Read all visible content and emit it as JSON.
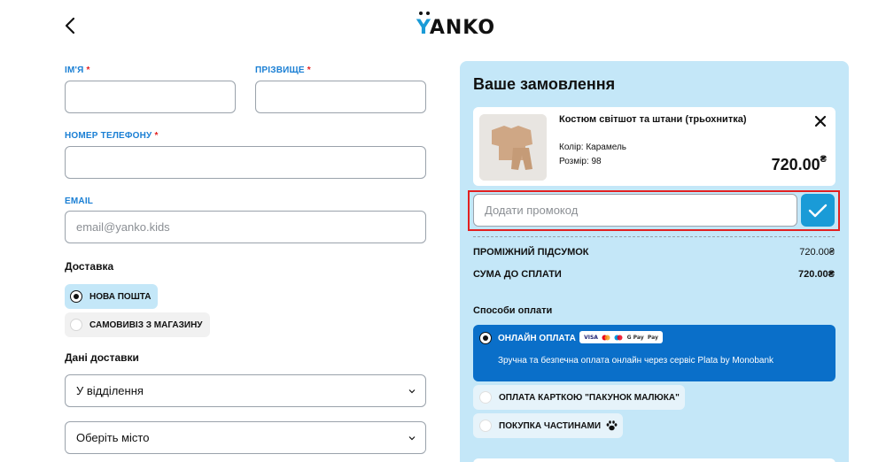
{
  "header": {
    "logo_text": "ANKO",
    "logo_letter": "Y"
  },
  "form": {
    "first_name": {
      "label": "ІМ'Я",
      "required_mark": "*",
      "value": ""
    },
    "last_name": {
      "label": "ПРІЗВИЩЕ",
      "required_mark": "*",
      "value": ""
    },
    "phone": {
      "label": "НОМЕР ТЕЛЕФОНУ",
      "required_mark": "*",
      "value": ""
    },
    "email": {
      "label": "EMAIL",
      "placeholder": "email@yanko.kids",
      "value": ""
    },
    "delivery": {
      "title": "Доставка",
      "options": [
        {
          "label": "НОВА ПОШТА",
          "selected": true
        },
        {
          "label": "САМОВИВІЗ З МАГАЗИНУ",
          "selected": false
        }
      ]
    },
    "delivery_data": {
      "title": "Дані доставки",
      "method_select": "У відділення",
      "city_select": "Оберіть місто"
    }
  },
  "order": {
    "title": "Ваше замовлення",
    "item": {
      "name": "Костюм світшот та штани (трьохнитка)",
      "color_label": "Колір:",
      "color_value": "Карамель",
      "size_label": "Розмір:",
      "size_value": "98",
      "price": "720.00",
      "currency": "₴"
    },
    "promo": {
      "placeholder": "Додати промокод",
      "value": ""
    },
    "subtotal": {
      "label": "ПРОМІЖНИЙ ПІДСУМОК",
      "value": "720.00₴"
    },
    "total": {
      "label": "СУМА ДО СПЛАТИ",
      "value": "720.00₴"
    },
    "payment": {
      "title": "Способи оплати",
      "methods": [
        {
          "label": "ОНЛАЙН ОПЛАТА",
          "selected": true,
          "description": "Зручна та безпечна оплата онлайн через сервіс Plata by Monobank",
          "icons": [
            "visa",
            "mastercard",
            "maestro",
            "google-pay",
            "apple-pay"
          ]
        },
        {
          "label": "ОПЛАТА КАРТКОЮ \"ПАКУНОК МАЛЮКА\"",
          "selected": false
        },
        {
          "label": "ПОКУПКА ЧАСТИНАМИ",
          "selected": false,
          "icon": "paw-icon"
        }
      ]
    }
  },
  "colors": {
    "accent": "#1a9bd7",
    "panel_bg": "#c4e7f8",
    "pay_active_bg": "#0a6fc9",
    "label_blue": "#1a7fd4",
    "required_red": "#e32020"
  }
}
